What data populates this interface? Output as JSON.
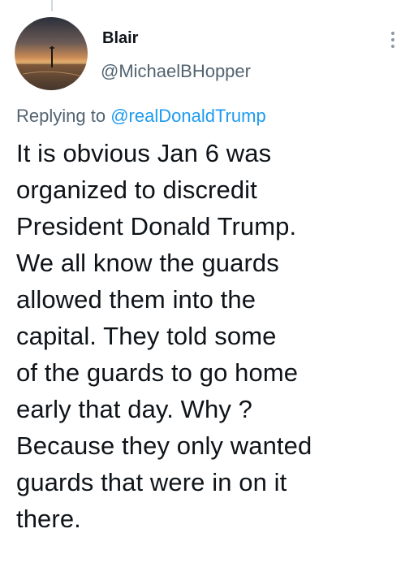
{
  "author": {
    "display_name": "Blair",
    "handle": "@MichaelBHopper"
  },
  "reply_context": {
    "prefix": "Replying to",
    "mention": "@realDonaldTrump"
  },
  "tweet": {
    "lines": [
      "It is obvious Jan 6 was",
      "organized to discredit",
      "President Donald Trump.",
      "We all know the guards",
      "allowed them into the",
      "capital. They told some",
      "of the guards to go home",
      "early that day. Why ?",
      "Because they only wanted",
      "guards that were in on it",
      "there."
    ]
  },
  "icons": {
    "more": "more-options-icon",
    "avatar": "avatar-image"
  },
  "colors": {
    "text_primary": "#0f1419",
    "text_secondary": "#536471",
    "link": "#1d9bf0"
  }
}
